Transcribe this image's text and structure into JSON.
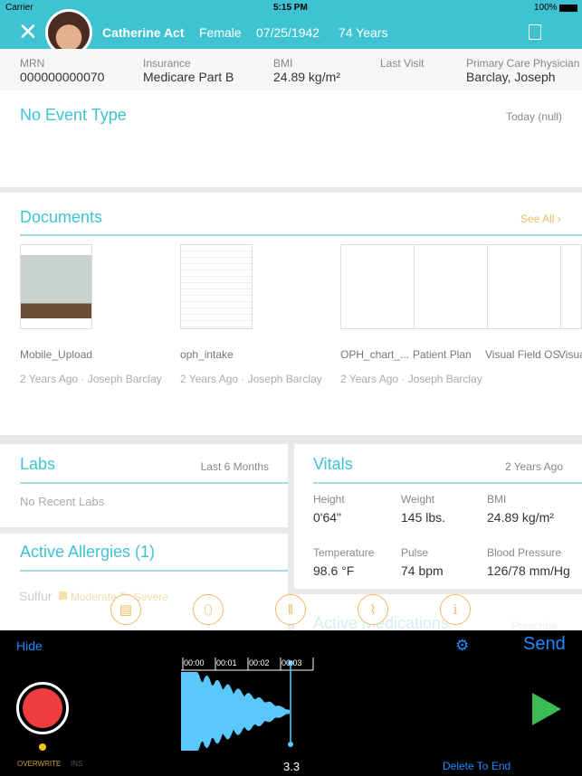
{
  "status": {
    "carrier": "Carrier",
    "time": "5:15 PM",
    "battery": "100%"
  },
  "header": {
    "name": "Catherine Act",
    "gender": "Female",
    "dob": "07/25/1942",
    "age": "74 Years"
  },
  "info": [
    {
      "label": "MRN",
      "value": "000000000070"
    },
    {
      "label": "Insurance",
      "value": "Medicare Part B"
    },
    {
      "label": "BMI",
      "value": "24.89 kg/m²"
    },
    {
      "label": "Last Visit",
      "value": ""
    },
    {
      "label": "Primary Care Physician",
      "value": "Barclay, Joseph"
    }
  ],
  "event": {
    "title": "No Event Type",
    "date": "Today (null)"
  },
  "documents": {
    "title": "Documents",
    "see_all": "See All ›",
    "items": [
      {
        "name": "Mobile_Upload",
        "meta": "2 Years Ago · Joseph Barclay"
      },
      {
        "name": "oph_intake",
        "meta": "2 Years Ago · Joseph Barclay"
      },
      {
        "name": "OPH_chart_...",
        "meta": "2 Years Ago · Joseph Barclay"
      },
      {
        "name": "Patient Plan"
      },
      {
        "name": "Visual Field OS"
      },
      {
        "name": "Visual"
      }
    ]
  },
  "labs": {
    "title": "Labs",
    "range": "Last 6 Months",
    "empty": "No Recent Labs"
  },
  "allergies": {
    "title": "Active Allergies (1)",
    "item": "Sulfur",
    "severity": "Moderate To Severe"
  },
  "vitals": {
    "title": "Vitals",
    "date": "2 Years Ago",
    "items": [
      {
        "label": "Height",
        "value": "0'64\""
      },
      {
        "label": "Weight",
        "value": "145 lbs."
      },
      {
        "label": "BMI",
        "value": "24.89 kg/m²"
      },
      {
        "label": "Temperature",
        "value": "98.6 °F"
      },
      {
        "label": "Pulse",
        "value": "74 bpm"
      },
      {
        "label": "Blood Pressure",
        "value": "126/78 mm/Hg"
      }
    ]
  },
  "medications": {
    "title": "Active Medications",
    "action": "Prescribe"
  },
  "toolbar_icons": [
    "document-icon",
    "pill-icon",
    "test-tubes-icon",
    "heartbeat-icon",
    "info-icon"
  ],
  "recorder": {
    "hide": "Hide",
    "send": "Send",
    "ticks": [
      "00:00",
      "00:01",
      "00:02",
      "00:03"
    ],
    "mode_overwrite": "OVERWRITE",
    "mode_insert": "INS",
    "duration": "3.3",
    "delete": "Delete To End"
  },
  "colors": {
    "accent": "#3fc3d3",
    "orange": "#f0b860",
    "record": "#f03c3c",
    "play": "#3cba54",
    "wave": "#5ac8fa"
  }
}
